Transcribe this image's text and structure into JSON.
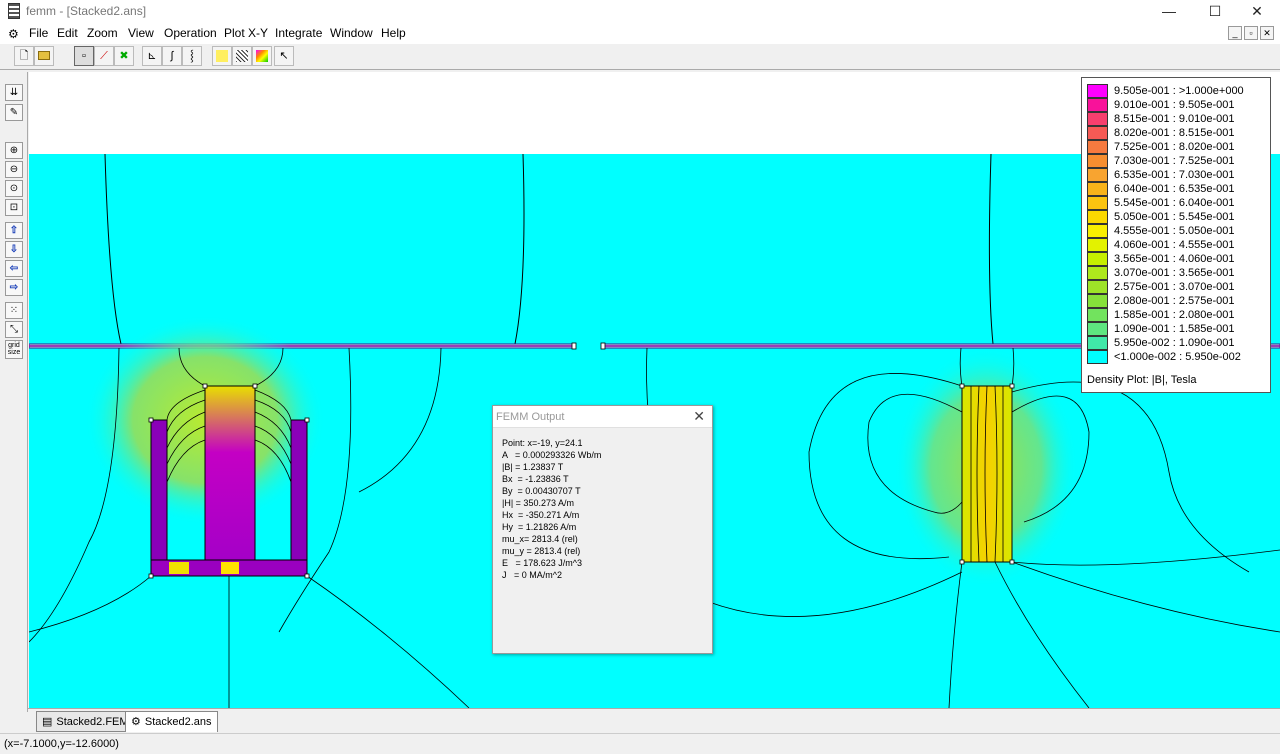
{
  "window": {
    "title": "femm - [Stacked2.ans]",
    "minimize": "—",
    "maximize": "☐",
    "close": "✕"
  },
  "menu": [
    "File",
    "Edit",
    "Zoom",
    "View",
    "Operation",
    "Plot X-Y",
    "Integrate",
    "Window",
    "Help"
  ],
  "mdi_controls": [
    "_",
    "▫",
    "✕"
  ],
  "toolbar": {
    "icons": [
      "new-file-icon",
      "open-folder-icon",
      "point-mode-icon",
      "line-mode-icon",
      "area-mode-icon",
      "plot-xy-icon",
      "integrate-icon",
      "line-integral-icon",
      "circuit-props-icon",
      "block-contour-icon",
      "density-plot-icon",
      "pointer-icon"
    ]
  },
  "left_toolbar": {
    "icons": [
      "show-mesh-icon",
      "edit-props-icon",
      "zoom-in-icon",
      "zoom-out-icon",
      "zoom-natural-icon",
      "zoom-window-icon",
      "pan-up-icon",
      "pan-down-icon",
      "pan-left-icon",
      "pan-right-icon",
      "show-grid-icon",
      "snap-grid-icon",
      "grid-size-icon"
    ],
    "grid_label_1": "grid",
    "grid_label_2": "size"
  },
  "legend": {
    "rows": [
      {
        "label": "9.505e-001 : >1.000e+000",
        "color": "#ff00ff"
      },
      {
        "label": "9.010e-001 : 9.505e-001",
        "color": "#f8129a"
      },
      {
        "label": "8.515e-001 : 9.010e-001",
        "color": "#f73f6e"
      },
      {
        "label": "8.020e-001 : 8.515e-001",
        "color": "#f65a55"
      },
      {
        "label": "7.525e-001 : 8.020e-001",
        "color": "#f67a3f"
      },
      {
        "label": "7.030e-001 : 7.525e-001",
        "color": "#f78e30"
      },
      {
        "label": "6.535e-001 : 7.030e-001",
        "color": "#f8a430"
      },
      {
        "label": "6.040e-001 : 6.535e-001",
        "color": "#f8b31a"
      },
      {
        "label": "5.545e-001 : 6.040e-001",
        "color": "#fac410"
      },
      {
        "label": "5.050e-001 : 5.545e-001",
        "color": "#fbd800"
      },
      {
        "label": "4.555e-001 : 5.050e-001",
        "color": "#f9ee00"
      },
      {
        "label": "4.060e-001 : 4.555e-001",
        "color": "#e3f200"
      },
      {
        "label": "3.565e-001 : 4.060e-001",
        "color": "#c6ee00"
      },
      {
        "label": "3.070e-001 : 3.565e-001",
        "color": "#aee81c"
      },
      {
        "label": "2.575e-001 : 3.070e-001",
        "color": "#9ee328"
      },
      {
        "label": "2.080e-001 : 2.575e-001",
        "color": "#86e03a"
      },
      {
        "label": "1.585e-001 : 2.080e-001",
        "color": "#72e35e"
      },
      {
        "label": "1.090e-001 : 1.585e-001",
        "color": "#5ee680"
      },
      {
        "label": "5.950e-002 : 1.090e-001",
        "color": "#40e8a8"
      },
      {
        "label": "<1.000e-002 : 5.950e-002",
        "color": "#00ffff"
      }
    ],
    "caption": "Density Plot: |B|, Tesla"
  },
  "output": {
    "title": "FEMM Output",
    "close": "✕",
    "lines": [
      "Point: x=-19, y=24.1",
      "A   = 0.000293326 Wb/m",
      "|B| = 1.23837 T",
      "Bx  = -1.23836 T",
      "By  = 0.00430707 T",
      "|H| = 350.273 A/m",
      "Hx  = -350.271 A/m",
      "Hy  = 1.21826 A/m",
      "mu_x= 2813.4 (rel)",
      "mu_y = 2813.4 (rel)",
      "E   = 178.623 J/m^3",
      "J   = 0 MA/m^2"
    ]
  },
  "tabs": [
    {
      "label": "Stacked2.FEM",
      "icon": "fem-file-icon"
    },
    {
      "label": "Stacked2.ans",
      "icon": "ans-file-icon"
    }
  ],
  "status": "(x=-7.1000,y=-12.6000)",
  "colors": {
    "background_field": "#00ffff",
    "iron_high": "#a100c8",
    "iron_mid": "#e4e800",
    "fringe": "#9bea52"
  }
}
